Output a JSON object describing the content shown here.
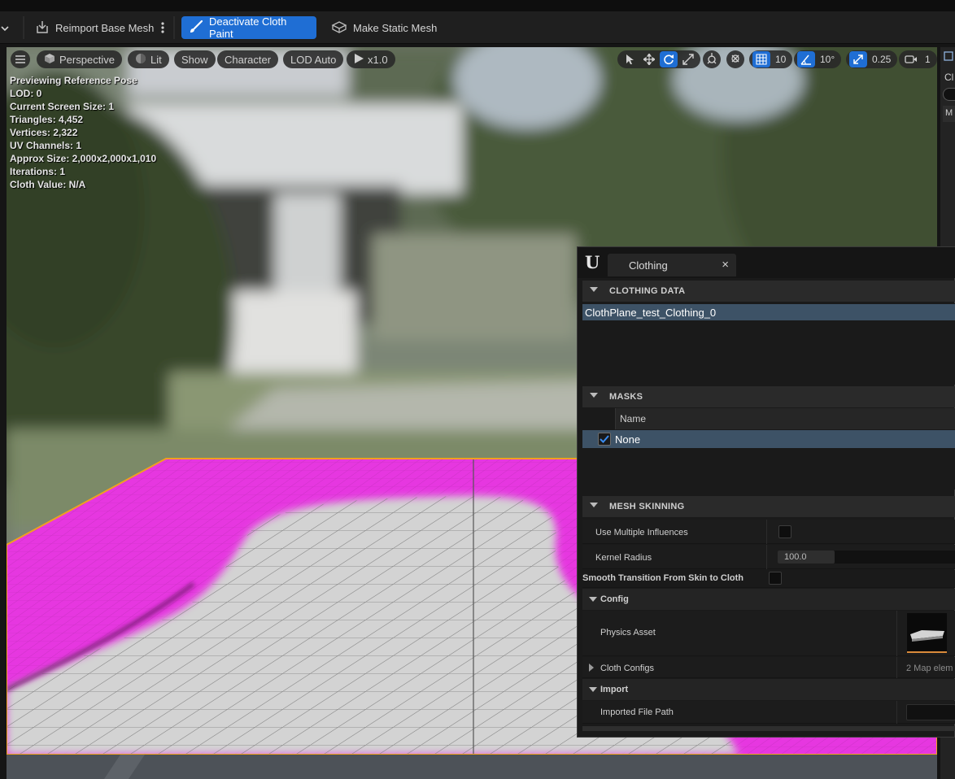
{
  "toolbar": {
    "reimport_label": "Reimport Base Mesh",
    "deactivate_label": "Deactivate Cloth Paint",
    "make_static_label": "Make Static Mesh"
  },
  "viewport": {
    "perspective_label": "Perspective",
    "lit_label": "Lit",
    "show_label": "Show",
    "character_label": "Character",
    "lod_label": "LOD Auto",
    "speed_label": "x1.0",
    "grid_snap_value": "10",
    "rotation_snap_value": "10°",
    "scale_snap_value": "0.25",
    "camera_speed_value": "1",
    "stats": [
      "Previewing Reference Pose",
      "LOD: 0",
      "Current Screen Size: 1",
      "Triangles: 4,452",
      "Vertices: 2,322",
      "UV Channels: 1",
      "Approx Size: 2,000x2,000x1,010",
      "Iterations: 1",
      "Cloth Value: N/A"
    ]
  },
  "right_edge": {
    "label_top": "Cl",
    "label_mid": "M"
  },
  "clothing_panel": {
    "tab_title": "Clothing",
    "clothing_data_header": "CLOTHING DATA",
    "clothing_data_items": [
      "ClothPlane_test_Clothing_0"
    ],
    "masks_header": "MASKS",
    "masks_column": "Name",
    "mask_items": [
      "None"
    ],
    "mesh_skinning_header": "MESH SKINNING",
    "use_multiple_influences_label": "Use Multiple Influences",
    "kernel_radius_label": "Kernel Radius",
    "kernel_radius_value": "100.0",
    "smooth_transition_label": "Smooth Transition From Skin to Cloth",
    "config_header": "Config",
    "physics_asset_label": "Physics Asset",
    "cloth_configs_label": "Cloth Configs",
    "cloth_configs_value": "2 Map elem",
    "import_header": "Import",
    "imported_file_path_label": "Imported File Path"
  },
  "colors": {
    "accent": "#1f6ed4",
    "selection": "#3d5266",
    "cloth_paint": "#e637e0",
    "selection_outline": "#f0a020"
  }
}
